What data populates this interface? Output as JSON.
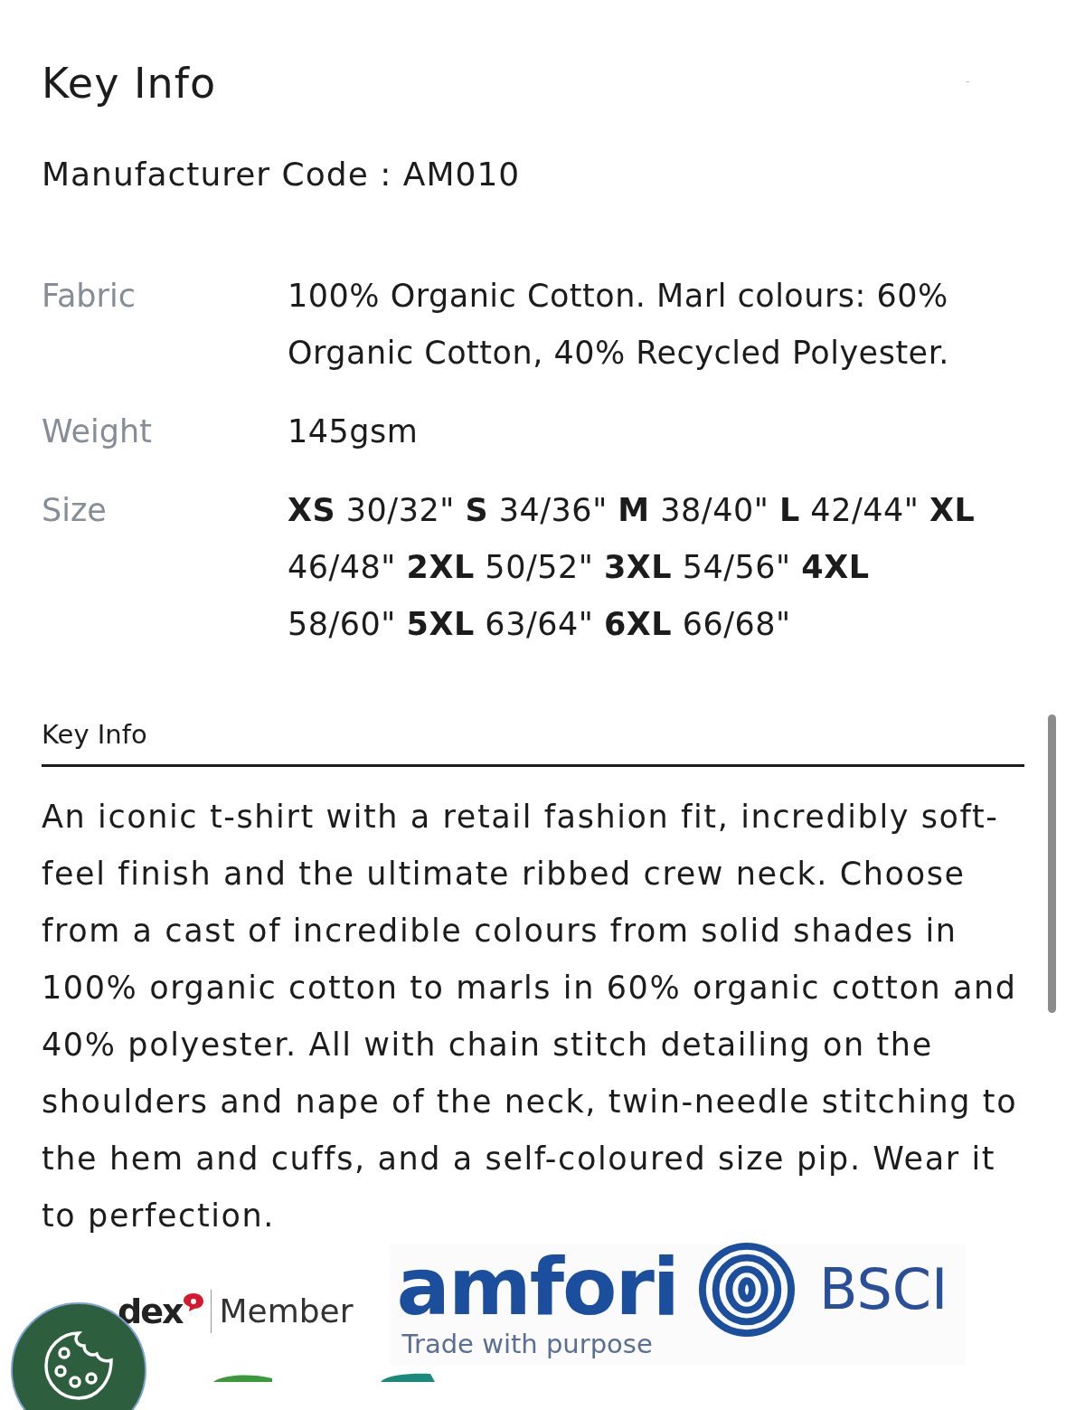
{
  "section": {
    "title": "Key Info",
    "expanded": true
  },
  "manufacturer_code": "Manufacturer Code : AM010",
  "specs": [
    {
      "label": "Fabric",
      "value": "100% Organic Cotton. Marl colours: 60% Organic Cotton, 40% Recycled Polyester."
    },
    {
      "label": "Weight",
      "value": "145gsm"
    },
    {
      "label": "Size",
      "value": "**XS** 30/32\" **S** 34/36\" **M** 38/40\" **L** 42/44\" **XL** 46/48\" **2XL** 50/52\" **3XL** 54/56\" **4XL** 58/60\" **5XL** 63/64\" **6XL** 66/68\""
    }
  ],
  "tabs": [
    {
      "label": "Key Info",
      "selected": true
    }
  ],
  "description": "An iconic t-shirt with a retail fashion fit, incredibly soft-feel finish and the ultimate ribbed crew neck. Choose from a cast of incredible colours from solid shades in 100% organic cotton to marls in 60% organic cotton and 40% polyester. All with chain stitch detailing on the shoulders and nape of the neck, twin-needle stitching to the hem and cuffs, and a self-coloured size pip. Wear it to perfection.",
  "badges": [
    {
      "kind": "sedex",
      "name": "dex",
      "caption": "Member"
    },
    {
      "kind": "amfori",
      "name": "amfori",
      "caption": "Trade with purpose",
      "suffix": "BSCI"
    }
  ]
}
